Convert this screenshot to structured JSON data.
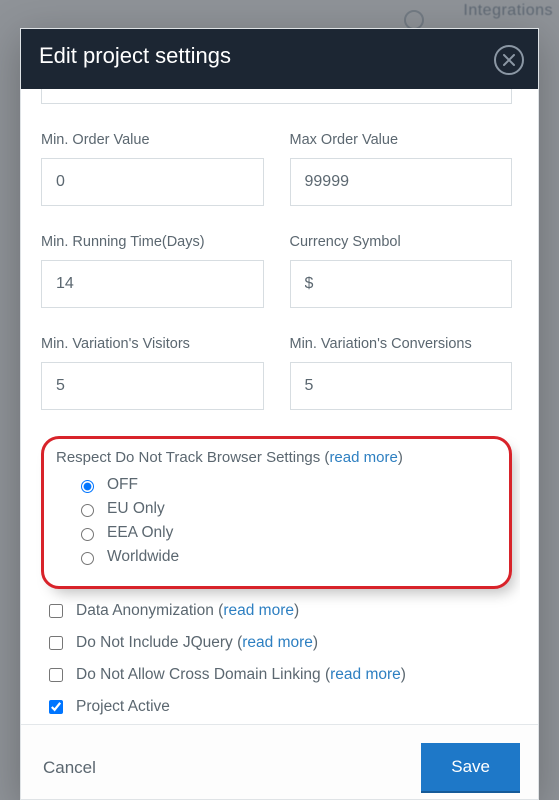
{
  "background": {
    "tabLabel": "Integrations"
  },
  "dialog": {
    "title": "Edit project settings",
    "closeLabel": "Close"
  },
  "fields": {
    "minOrderValue": {
      "label": "Min. Order Value",
      "value": "0"
    },
    "maxOrderValue": {
      "label": "Max Order Value",
      "value": "99999"
    },
    "minRunningTime": {
      "label": "Min. Running Time(Days)",
      "value": "14"
    },
    "currencySymbol": {
      "label": "Currency Symbol",
      "value": "$"
    },
    "minVariationVisitors": {
      "label": "Min. Variation's Visitors",
      "value": "5"
    },
    "minVariationConversions": {
      "label": "Min. Variation's Conversions",
      "value": "5"
    }
  },
  "dnt": {
    "legendPrefix": "Respect Do Not Track Browser Settings (",
    "readMore": "read more",
    "legendSuffix": ")",
    "options": {
      "off": "OFF",
      "euOnly": "EU Only",
      "eeaOnly": "EEA Only",
      "worldwide": "Worldwide"
    },
    "selected": "off"
  },
  "checks": {
    "anonymization": {
      "labelPrefix": "Data Anonymization (",
      "readMore": "read more",
      "labelSuffix": ")",
      "checked": false
    },
    "noJquery": {
      "labelPrefix": "Do Not Include JQuery (",
      "readMore": "read more",
      "labelSuffix": ")",
      "checked": false
    },
    "noCrossDomain": {
      "labelPrefix": "Do Not Allow Cross Domain Linking (",
      "readMore": "read more",
      "labelSuffix": ")",
      "checked": false
    },
    "projectActive": {
      "label": "Project Active",
      "checked": true
    }
  },
  "footer": {
    "cancel": "Cancel",
    "save": "Save"
  }
}
